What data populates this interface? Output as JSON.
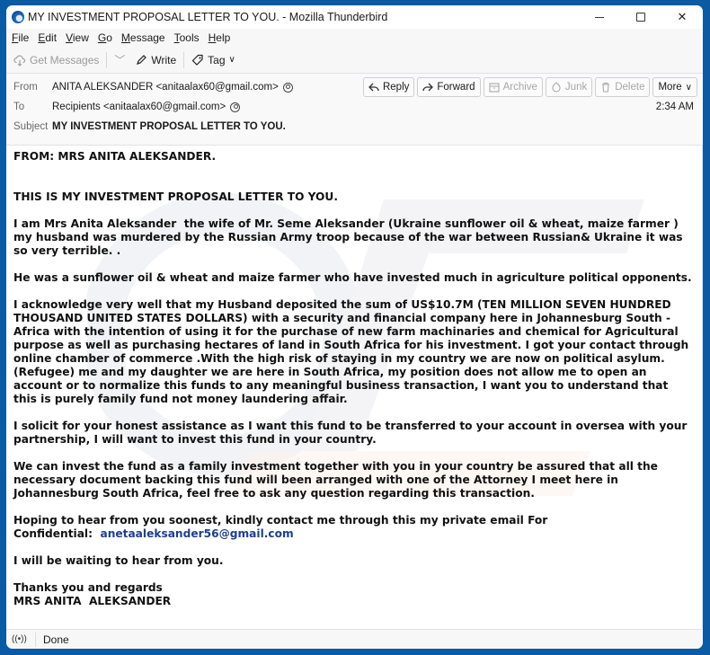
{
  "window": {
    "title": "MY INVESTMENT PROPOSAL LETTER TO YOU. - Mozilla Thunderbird",
    "app_icon": "thunderbird-logo-icon",
    "controls": [
      "minimize-icon",
      "maximize-icon",
      "close-icon"
    ]
  },
  "menu": [
    {
      "accel": "F",
      "rest": "ile"
    },
    {
      "accel": "E",
      "rest": "dit"
    },
    {
      "accel": "V",
      "rest": "iew"
    },
    {
      "accel": "G",
      "rest": "o"
    },
    {
      "accel": "M",
      "rest": "essage"
    },
    {
      "accel": "T",
      "rest": "ools"
    },
    {
      "accel": "H",
      "rest": "elp"
    }
  ],
  "toolbar": {
    "get_messages": "Get Messages",
    "write": "Write",
    "tag": "Tag"
  },
  "header": {
    "from_label": "From",
    "from_value": "ANITA ALEKSANDER <anitaalax60@gmail.com>",
    "to_label": "To",
    "to_value": "Recipients <anitaalax60@gmail.com>",
    "subject_label": "Subject",
    "subject_value": "MY INVESTMENT PROPOSAL LETTER TO YOU.",
    "time": "2:34 AM",
    "actions": {
      "reply": "Reply",
      "forward": "Forward",
      "archive": "Archive",
      "junk": "Junk",
      "delete": "Delete",
      "more": "More"
    }
  },
  "body": {
    "from_line": "FROM: MRS ANITA ALEKSANDER.",
    "heading": "THIS IS MY INVESTMENT PROPOSAL LETTER TO YOU.",
    "p1": "I am Mrs Anita Aleksander  the wife of Mr. Seme Aleksander (Ukraine sunflower oil & wheat, maize farmer ) my husband was murdered by the Russian Army troop because of the war between Russian& Ukraine it was so very terrible. .",
    "p2": "He was a sunflower oil & wheat and maize farmer who have invested much in agriculture political opponents.",
    "p3": "I acknowledge very well that my Husband deposited the sum of US$10.7M (TEN MILLION SEVEN HUNDRED THOUSAND UNITED STATES DOLLARS) with a security and financial company here in Johannesburg South -Africa with the intention of using it for the purchase of new farm machinaries and chemical for Agricultural purpose as well as purchasing hectares of land in South Africa for his investment. I got your contact through online chamber of commerce .With the high risk of staying in my country we are now on political asylum. (Refugee) me and my daughter we are here in South Africa, my position does not allow me to open an account or to normalize this funds to any meaningful business transaction, I want you to understand that this is purely family fund not money laundering affair.",
    "p4": "I solicit for your honest assistance as I want this fund to be transferred to your account in oversea with your partnership, I will want to invest this fund in your country.",
    "p5": "We can invest the fund as a family investment together with you in your country be assured that all the necessary document backing this fund will been arranged with one of the Attorney I meet here in Johannesburg South Africa, feel free to ask any question regarding this transaction.",
    "p6": "Hoping to hear from you soonest, kindly contact me through this my private email For",
    "p6_label": "Confidential:  ",
    "p6_email": "anetaaleksander56@gmail.com",
    "p7": "I will be waiting to hear from you.",
    "closing": "Thanks you and regards",
    "signature": "MRS ANITA  ALEKSANDER",
    "link_color": "#1d3f8f"
  },
  "status": {
    "icon": "wifi-status-icon",
    "text": "Done"
  }
}
